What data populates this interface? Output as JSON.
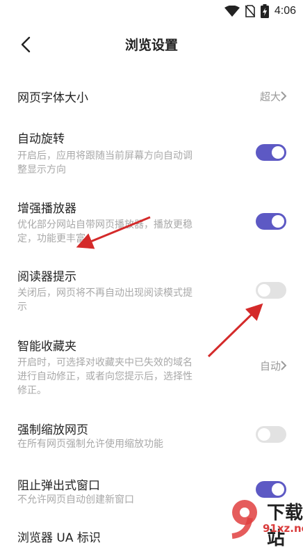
{
  "status_bar": {
    "time": "4:06",
    "icons": [
      "wifi-icon",
      "no-sim-icon",
      "battery-charging-icon"
    ]
  },
  "header": {
    "title": "浏览设置",
    "back_icon": "back-arrow-icon"
  },
  "settings": [
    {
      "title": "网页字体大小",
      "value": "超大"
    },
    {
      "title": "自动旋转",
      "desc_lines": [
        "开启后，应用将跟随当前屏幕方向自动调",
        "整显示方向"
      ],
      "enabled": true
    },
    {
      "title": "增强播放器",
      "desc_lines": [
        "优化部分网站自带网页播放器，播放更稳",
        "定，功能更丰富"
      ],
      "enabled": true
    },
    {
      "title": "阅读器提示",
      "desc_lines": [
        "关闭后，网页将不再自动出现阅读模式提",
        "示"
      ],
      "enabled": false
    },
    {
      "title": "智能收藏夹",
      "desc_lines": [
        "开启时，可选择对收藏夹中已失效的域名",
        "进行自动修正，或者向您提示后，选择性",
        "修正。"
      ],
      "value": "自动"
    },
    {
      "title": "强制缩放网页",
      "desc_lines": [
        "在所有网页强制允许使用缩放功能"
      ],
      "enabled": false
    },
    {
      "title": "阻止弹出式窗口",
      "desc_lines": [
        "不允许网页自动创建新窗口"
      ],
      "enabled": true
    },
    {
      "title": "浏览器 UA 标识"
    }
  ],
  "colors": {
    "toggle_on": "#5d59c4",
    "toggle_off": "#e2e2e2",
    "annotation_arrow": "#d42a2a"
  },
  "watermark": {
    "line1": "下载站",
    "line2": "91xz.net"
  }
}
